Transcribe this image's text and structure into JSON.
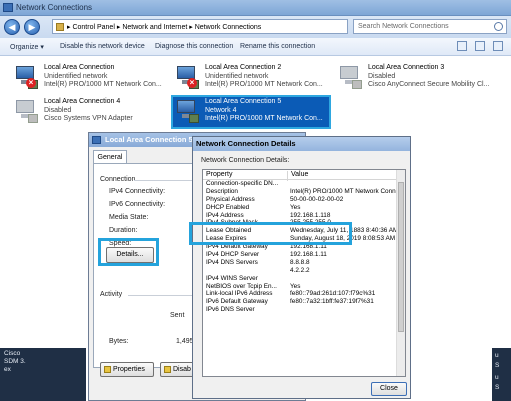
{
  "window": {
    "title": "Network Connections"
  },
  "address": {
    "crumbs": [
      "Control Panel",
      "Network and Internet",
      "Network Connections"
    ],
    "separator": "▸",
    "search_placeholder": "Search Network Connections"
  },
  "toolbar": {
    "organize": "Organize ▾",
    "disable": "Disable this network device",
    "diagnose": "Diagnose this connection",
    "rename": "Rename this connection"
  },
  "connections": [
    {
      "name": "Local Area Connection",
      "status": "Unidentified network",
      "adapter": "Intel(R) PRO/1000 MT Network Con..."
    },
    {
      "name": "Local Area Connection 2",
      "status": "Unidentified network",
      "adapter": "Intel(R) PRO/1000 MT Network Con..."
    },
    {
      "name": "Local Area Connection 3",
      "status": "Disabled",
      "adapter": "Cisco AnyConnect Secure Mobility Cl..."
    },
    {
      "name": "Local Area Connection 4",
      "status": "Disabled",
      "adapter": "Cisco Systems VPN Adapter"
    },
    {
      "name": "Local Area Connection 5",
      "status": "Network  4",
      "adapter": "Intel(R) PRO/1000 MT Network Con..."
    }
  ],
  "status_dialog": {
    "title": "Local Area Connection 5 S",
    "tab": "General",
    "connection_heading": "Connection",
    "labels": [
      "IPv4 Connectivity:",
      "IPv6 Connectivity:",
      "Media State:",
      "Duration:",
      "Speed:"
    ],
    "details_button": "Details...",
    "activity_heading": "Activity",
    "sent_label": "Sent",
    "bytes_label": "Bytes:",
    "bytes_value": "1,495,",
    "properties_button": "Properties",
    "disable_button": "Disab"
  },
  "details_dialog": {
    "title": "Network Connection Details",
    "caption": "Network Connection Details:",
    "col_property": "Property",
    "col_value": "Value",
    "rows": [
      {
        "k": "Connection-specific DN...",
        "v": ""
      },
      {
        "k": "Description",
        "v": "Intel(R) PRO/1000 MT Network Conn"
      },
      {
        "k": "Physical Address",
        "v": "50-00-00-02-00-02"
      },
      {
        "k": "DHCP Enabled",
        "v": "Yes"
      },
      {
        "k": "IPv4 Address",
        "v": "192.168.1.118"
      },
      {
        "k": "IPv4 Subnet Mask",
        "v": "255.255.255.0"
      },
      {
        "k": "Lease Obtained",
        "v": "Wednesday, July 11, 1883 8:40:36 AM"
      },
      {
        "k": "Lease Expires",
        "v": "Sunday, August 18, 2019 8:08:53 AM"
      },
      {
        "k": "IPv4 Default Gateway",
        "v": "192.168.1.11"
      },
      {
        "k": "IPv4 DHCP Server",
        "v": "192.168.1.11"
      },
      {
        "k": "IPv4 DNS Servers",
        "v": "8.8.8.8"
      },
      {
        "k": "",
        "v": "4.2.2.2"
      },
      {
        "k": "IPv4 WINS Server",
        "v": ""
      },
      {
        "k": "NetBIOS over Tcpip En...",
        "v": "Yes"
      },
      {
        "k": "Link-local IPv6 Address",
        "v": "fe80::79ad:261d:107:f79c%31"
      },
      {
        "k": "IPv6 Default Gateway",
        "v": "fe80::7a32:1bff:fe37:19f7%31"
      },
      {
        "k": "IPv6 DNS Server",
        "v": ""
      }
    ],
    "close_button": "Close"
  },
  "taskbar": {
    "left_lines": [
      "Cisco",
      "SDM 3.",
      "ex"
    ],
    "right_lines": [
      "u",
      "S",
      "u",
      "S"
    ]
  },
  "colors": {
    "selection": "#0b5bb6",
    "highlight_box": "#24a3dc"
  }
}
